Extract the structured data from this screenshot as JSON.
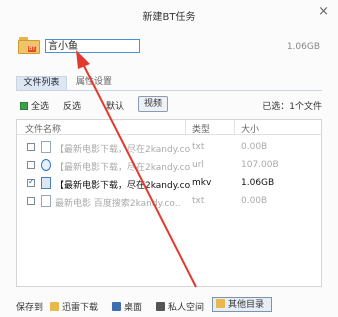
{
  "dialog": {
    "title": "新建BT任务",
    "close_label": "×"
  },
  "torrent": {
    "folder_badge": "BT",
    "folder_name": "言小鱼",
    "total_size": "1.06GB"
  },
  "tabs": [
    {
      "label": "文件列表"
    },
    {
      "label": "属性设置"
    }
  ],
  "toolbar": {
    "select_all": "全选",
    "invert": "反选",
    "default": "默认",
    "video": "视频",
    "selected_count": "已选：1个文件"
  },
  "table": {
    "headers": [
      "文件名称",
      "类型",
      "大小"
    ],
    "rows": [
      {
        "name": "【最新电影下载，尽在2kandy.co...",
        "type": "txt",
        "size": "0.00B"
      },
      {
        "name": "【最新电影下载，尽在2kandy.co...",
        "type": "url",
        "size": "107.00B"
      },
      {
        "name": "【最新电影下载，尽在2kandy.co...",
        "type": "mkv",
        "size": "1.06GB"
      },
      {
        "name": "最新电影 百度搜索2kandy.co..",
        "type": "txt",
        "size": "0.00B"
      }
    ]
  },
  "save_to": {
    "label": "保存到",
    "options": [
      "迅雷下载",
      "桌面",
      "私人空间",
      "其他目录"
    ]
  },
  "colors": {
    "arrow": "#e23a2e",
    "accent": "#4a8fd8"
  }
}
